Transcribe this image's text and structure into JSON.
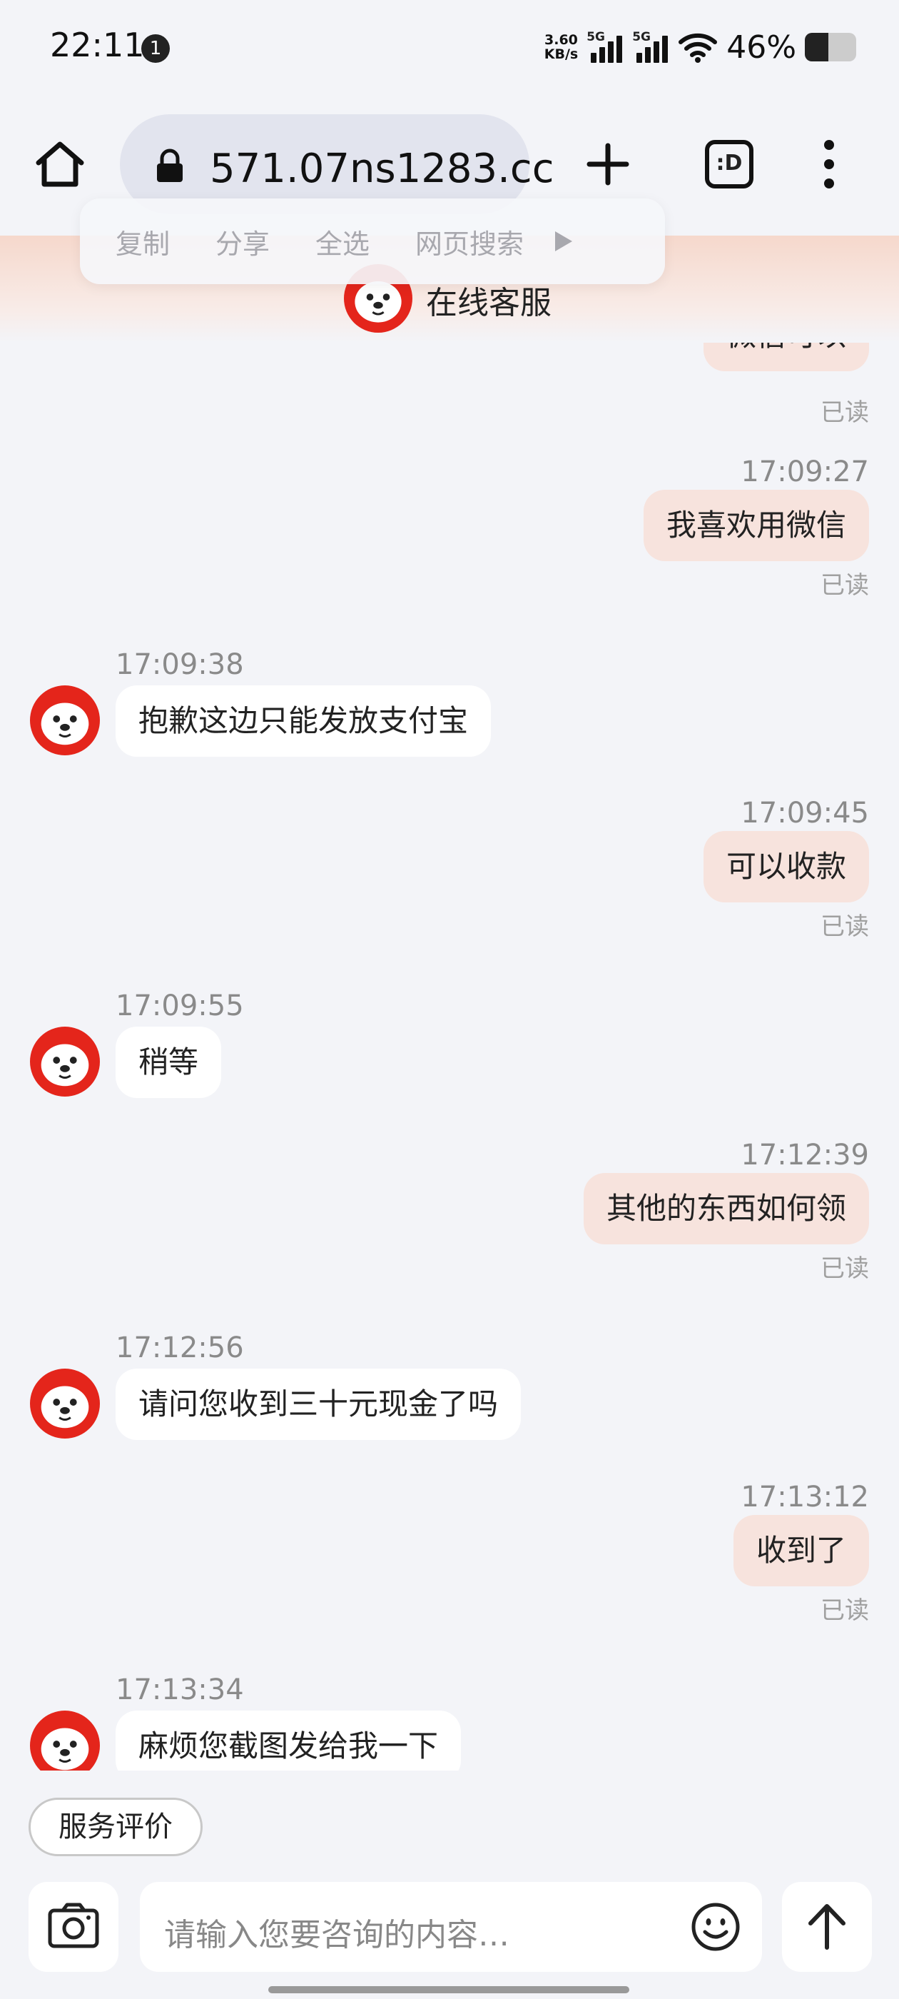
{
  "status_bar": {
    "time": "22:11",
    "notif_count": "1",
    "speed_value": "3.60",
    "speed_unit": "KB/s",
    "sim1_label": "5G",
    "sim2_label": "5G",
    "battery_percent": "46%",
    "battery_level": 0.46
  },
  "browser": {
    "url": "571.07ns1283.cc",
    "tabs_label": ":D",
    "icons": [
      "home-icon",
      "lock-icon",
      "plus-icon",
      "tabs-icon",
      "more-vertical-icon"
    ]
  },
  "selection_menu": {
    "items": [
      "复制",
      "分享",
      "全选",
      "网页搜索"
    ],
    "more_icon": "triangle-right-icon"
  },
  "chat_header": {
    "title": "在线客服"
  },
  "messages": [
    {
      "dir": "out",
      "time": "17:09:27",
      "text": "我喜欢用微信",
      "status": "已读"
    },
    {
      "dir": "in",
      "time": "17:09:38",
      "text": "抱歉这边只能发放支付宝"
    },
    {
      "dir": "out",
      "time": "17:09:45",
      "text": "可以收款",
      "status": "已读"
    },
    {
      "dir": "in",
      "time": "17:09:55",
      "text": "稍等"
    },
    {
      "dir": "out",
      "time": "17:12:39",
      "text": "其他的东西如何领",
      "status": "已读"
    },
    {
      "dir": "in",
      "time": "17:12:56",
      "text": "请问您收到三十元现金了吗"
    },
    {
      "dir": "out",
      "time": "17:13:12",
      "text": "收到了",
      "status": "已读"
    },
    {
      "dir": "in",
      "time": "17:13:34",
      "text": "麻烦您截图发给我一下"
    }
  ],
  "top_partial": {
    "text": "微信可以",
    "status": "已读"
  },
  "bottom": {
    "rate_label": "服务评价",
    "input_placeholder": "请输入您要咨询的内容…",
    "icons": [
      "camera-icon",
      "emoji-icon",
      "send-arrow-icon"
    ]
  },
  "colors": {
    "accent": "#e4251b",
    "out_bubble": "#f7e3dd",
    "in_bubble": "#ffffff",
    "background": "#f3f4f8"
  }
}
